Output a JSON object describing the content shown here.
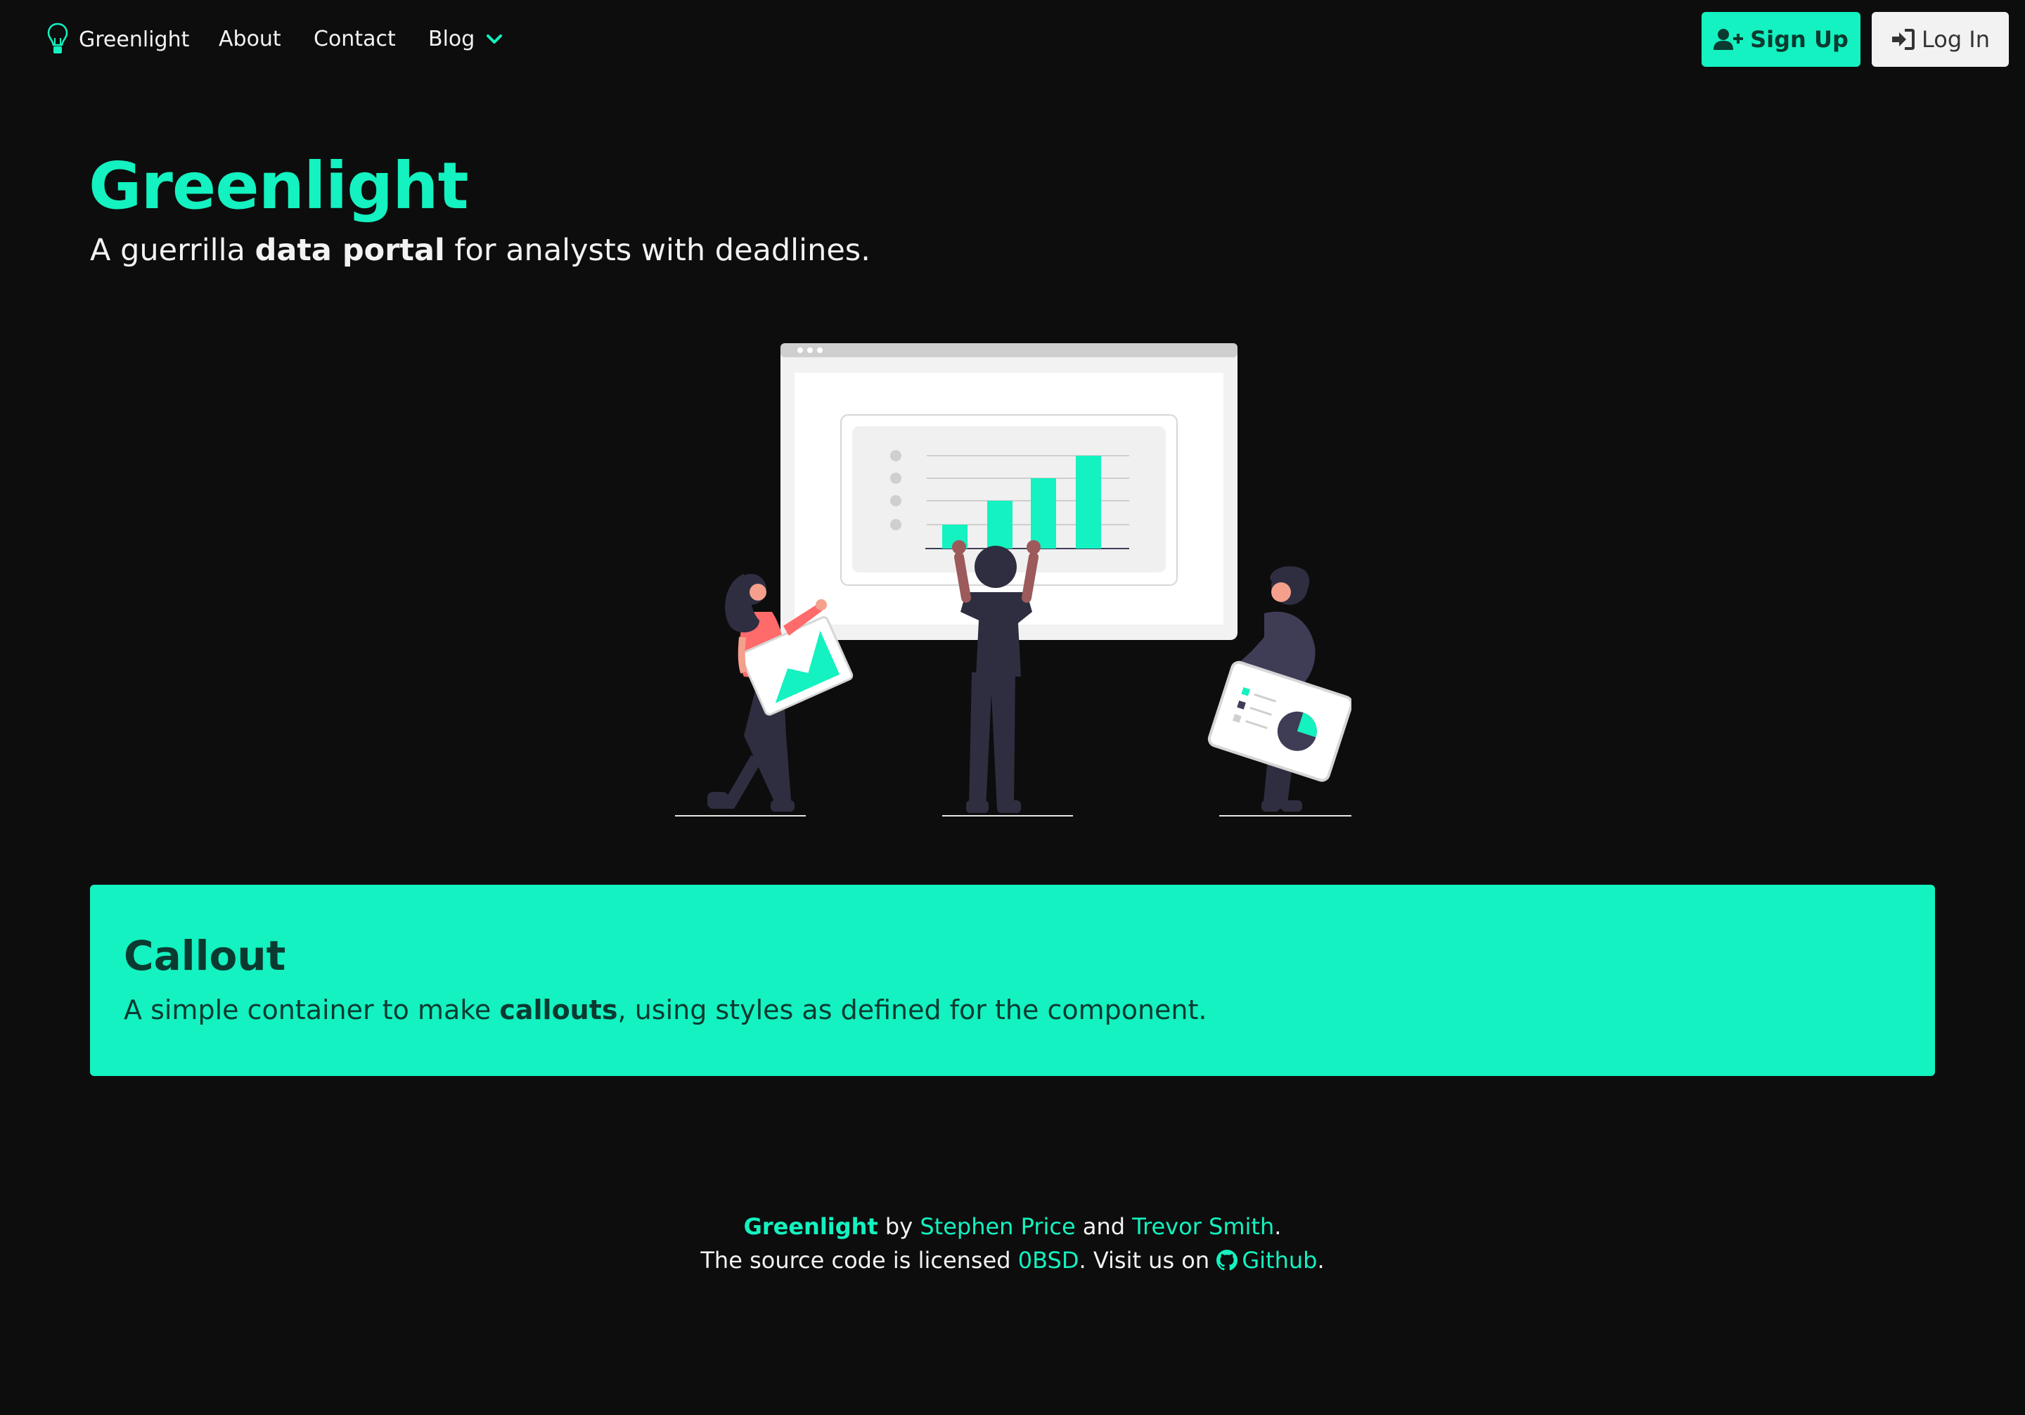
{
  "colors": {
    "accent": "#13f2c0",
    "background": "#0d0d0d",
    "text": "#f2f2f2",
    "dark_text": "#0b3a30"
  },
  "nav": {
    "brand": "Greenlight",
    "brand_icon": "lightbulb-icon",
    "links": [
      {
        "label": "About"
      },
      {
        "label": "Contact"
      },
      {
        "label": "Blog",
        "icon": "chevron-down-icon"
      }
    ],
    "signup": {
      "label": "Sign Up",
      "icon": "user-plus-icon"
    },
    "login": {
      "label": "Log In",
      "icon": "sign-in-icon"
    }
  },
  "hero": {
    "title": "Greenlight",
    "subtitle": {
      "prefix": "A guerrilla ",
      "bold": "data portal",
      "suffix": " for analysts with deadlines."
    },
    "illustration": "people-presenting-charts-illustration"
  },
  "callout": {
    "title": "Callout",
    "body": {
      "prefix": "A simple container to make ",
      "bold": "callouts",
      "suffix": ", using styles as defined for the component."
    }
  },
  "footer": {
    "line1": {
      "brand": "Greenlight",
      "by": " by ",
      "author1": "Stephen Price",
      "and": " and ",
      "author2": "Trevor Smith",
      "end": "."
    },
    "line2": {
      "prefix": "The source code is licensed ",
      "license": "0BSD",
      "mid": ". Visit us on ",
      "github_icon": "github-icon",
      "github": "Github",
      "end": "."
    }
  }
}
